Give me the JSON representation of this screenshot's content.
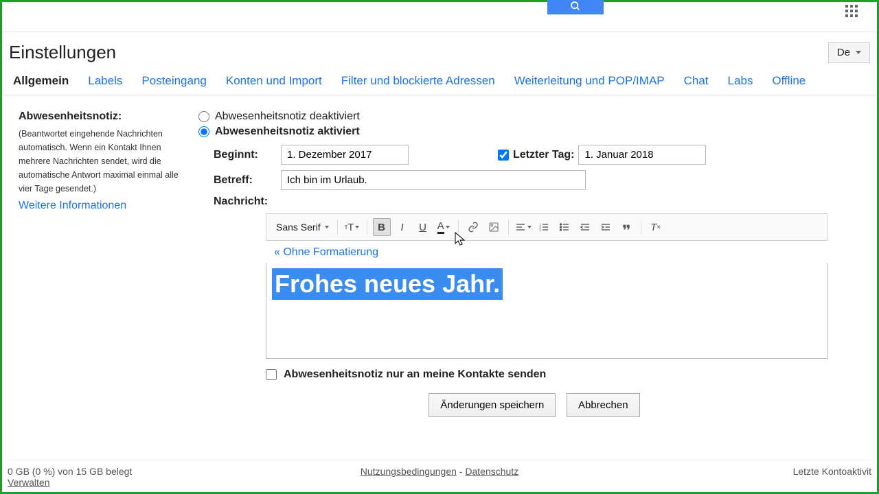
{
  "header": {
    "title": "Einstellungen",
    "language": "De"
  },
  "tabs": [
    "Allgemein",
    "Labels",
    "Posteingang",
    "Konten und Import",
    "Filter und blockierte Adressen",
    "Weiterleitung und POP/IMAP",
    "Chat",
    "Labs",
    "Offline"
  ],
  "section": {
    "title": "Abwesenheitsnotiz:",
    "desc": "(Beantwortet eingehende Nachrichten automatisch. Wenn ein Kontakt Ihnen mehrere Nachrichten sendet, wird die automatische Antwort maximal einmal alle vier Tage gesendet.)",
    "more": "Weitere Informationen"
  },
  "radios": {
    "off": "Abwesenheitsnotiz deaktiviert",
    "on": "Abwesenheitsnotiz aktiviert"
  },
  "fields": {
    "begins_label": "Beginnt:",
    "begins_value": "1. Dezember 2017",
    "lastday_label": "Letzter Tag:",
    "lastday_value": "1. Januar 2018",
    "subject_label": "Betreff:",
    "subject_value": "Ich bin im Urlaub.",
    "message_label": "Nachricht:"
  },
  "toolbar": {
    "font": "Sans Serif"
  },
  "plain_link": "« Ohne Formatierung",
  "message_body": "Frohes neues Jahr.",
  "contacts_only": "Abwesenheitsnotiz nur an meine Kontakte senden",
  "buttons": {
    "save": "Änderungen speichern",
    "cancel": "Abbrechen"
  },
  "footer": {
    "storage": "0 GB (0 %) von 15 GB belegt",
    "manage": "Verwalten",
    "terms": "Nutzungsbedingungen",
    "privacy": "Datenschutz",
    "activity": "Letzte Kontoaktivit"
  }
}
